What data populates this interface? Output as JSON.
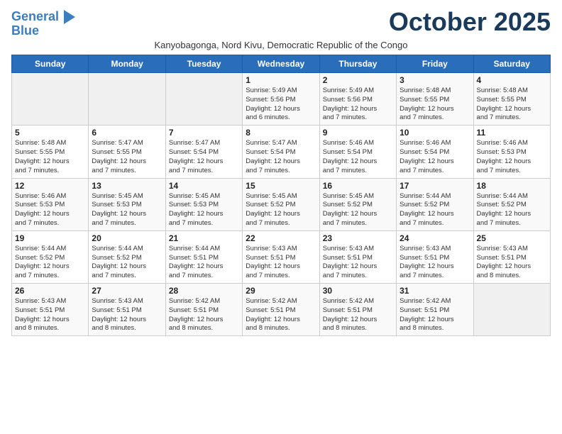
{
  "logo": {
    "line1": "General",
    "line2": "Blue"
  },
  "title": "October 2025",
  "subtitle": "Kanyobagonga, Nord Kivu, Democratic Republic of the Congo",
  "days_of_week": [
    "Sunday",
    "Monday",
    "Tuesday",
    "Wednesday",
    "Thursday",
    "Friday",
    "Saturday"
  ],
  "weeks": [
    [
      {
        "day": "",
        "info": ""
      },
      {
        "day": "",
        "info": ""
      },
      {
        "day": "",
        "info": ""
      },
      {
        "day": "1",
        "info": "Sunrise: 5:49 AM\nSunset: 5:56 PM\nDaylight: 12 hours\nand 6 minutes."
      },
      {
        "day": "2",
        "info": "Sunrise: 5:49 AM\nSunset: 5:56 PM\nDaylight: 12 hours\nand 7 minutes."
      },
      {
        "day": "3",
        "info": "Sunrise: 5:48 AM\nSunset: 5:55 PM\nDaylight: 12 hours\nand 7 minutes."
      },
      {
        "day": "4",
        "info": "Sunrise: 5:48 AM\nSunset: 5:55 PM\nDaylight: 12 hours\nand 7 minutes."
      }
    ],
    [
      {
        "day": "5",
        "info": "Sunrise: 5:48 AM\nSunset: 5:55 PM\nDaylight: 12 hours\nand 7 minutes."
      },
      {
        "day": "6",
        "info": "Sunrise: 5:47 AM\nSunset: 5:55 PM\nDaylight: 12 hours\nand 7 minutes."
      },
      {
        "day": "7",
        "info": "Sunrise: 5:47 AM\nSunset: 5:54 PM\nDaylight: 12 hours\nand 7 minutes."
      },
      {
        "day": "8",
        "info": "Sunrise: 5:47 AM\nSunset: 5:54 PM\nDaylight: 12 hours\nand 7 minutes."
      },
      {
        "day": "9",
        "info": "Sunrise: 5:46 AM\nSunset: 5:54 PM\nDaylight: 12 hours\nand 7 minutes."
      },
      {
        "day": "10",
        "info": "Sunrise: 5:46 AM\nSunset: 5:54 PM\nDaylight: 12 hours\nand 7 minutes."
      },
      {
        "day": "11",
        "info": "Sunrise: 5:46 AM\nSunset: 5:53 PM\nDaylight: 12 hours\nand 7 minutes."
      }
    ],
    [
      {
        "day": "12",
        "info": "Sunrise: 5:46 AM\nSunset: 5:53 PM\nDaylight: 12 hours\nand 7 minutes."
      },
      {
        "day": "13",
        "info": "Sunrise: 5:45 AM\nSunset: 5:53 PM\nDaylight: 12 hours\nand 7 minutes."
      },
      {
        "day": "14",
        "info": "Sunrise: 5:45 AM\nSunset: 5:53 PM\nDaylight: 12 hours\nand 7 minutes."
      },
      {
        "day": "15",
        "info": "Sunrise: 5:45 AM\nSunset: 5:52 PM\nDaylight: 12 hours\nand 7 minutes."
      },
      {
        "day": "16",
        "info": "Sunrise: 5:45 AM\nSunset: 5:52 PM\nDaylight: 12 hours\nand 7 minutes."
      },
      {
        "day": "17",
        "info": "Sunrise: 5:44 AM\nSunset: 5:52 PM\nDaylight: 12 hours\nand 7 minutes."
      },
      {
        "day": "18",
        "info": "Sunrise: 5:44 AM\nSunset: 5:52 PM\nDaylight: 12 hours\nand 7 minutes."
      }
    ],
    [
      {
        "day": "19",
        "info": "Sunrise: 5:44 AM\nSunset: 5:52 PM\nDaylight: 12 hours\nand 7 minutes."
      },
      {
        "day": "20",
        "info": "Sunrise: 5:44 AM\nSunset: 5:52 PM\nDaylight: 12 hours\nand 7 minutes."
      },
      {
        "day": "21",
        "info": "Sunrise: 5:44 AM\nSunset: 5:51 PM\nDaylight: 12 hours\nand 7 minutes."
      },
      {
        "day": "22",
        "info": "Sunrise: 5:43 AM\nSunset: 5:51 PM\nDaylight: 12 hours\nand 7 minutes."
      },
      {
        "day": "23",
        "info": "Sunrise: 5:43 AM\nSunset: 5:51 PM\nDaylight: 12 hours\nand 7 minutes."
      },
      {
        "day": "24",
        "info": "Sunrise: 5:43 AM\nSunset: 5:51 PM\nDaylight: 12 hours\nand 7 minutes."
      },
      {
        "day": "25",
        "info": "Sunrise: 5:43 AM\nSunset: 5:51 PM\nDaylight: 12 hours\nand 8 minutes."
      }
    ],
    [
      {
        "day": "26",
        "info": "Sunrise: 5:43 AM\nSunset: 5:51 PM\nDaylight: 12 hours\nand 8 minutes."
      },
      {
        "day": "27",
        "info": "Sunrise: 5:43 AM\nSunset: 5:51 PM\nDaylight: 12 hours\nand 8 minutes."
      },
      {
        "day": "28",
        "info": "Sunrise: 5:42 AM\nSunset: 5:51 PM\nDaylight: 12 hours\nand 8 minutes."
      },
      {
        "day": "29",
        "info": "Sunrise: 5:42 AM\nSunset: 5:51 PM\nDaylight: 12 hours\nand 8 minutes."
      },
      {
        "day": "30",
        "info": "Sunrise: 5:42 AM\nSunset: 5:51 PM\nDaylight: 12 hours\nand 8 minutes."
      },
      {
        "day": "31",
        "info": "Sunrise: 5:42 AM\nSunset: 5:51 PM\nDaylight: 12 hours\nand 8 minutes."
      },
      {
        "day": "",
        "info": ""
      }
    ]
  ]
}
